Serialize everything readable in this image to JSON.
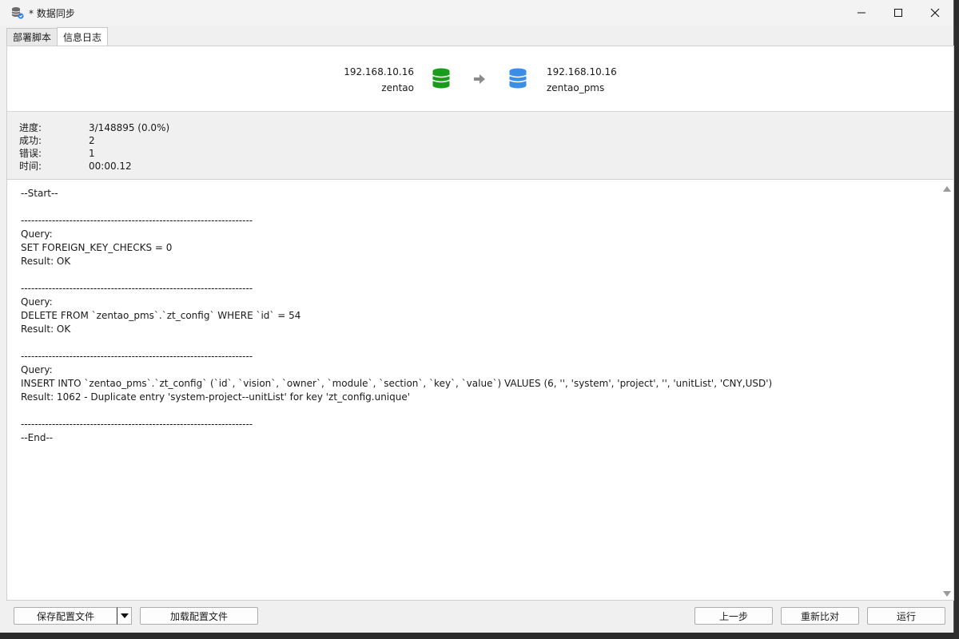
{
  "window": {
    "title": "* 数据同步"
  },
  "tabs": [
    {
      "label": "部署脚本",
      "active": false
    },
    {
      "label": "信息日志",
      "active": true
    }
  ],
  "connection": {
    "source": {
      "host": "192.168.10.16",
      "database": "zentao",
      "color": "#1a9b1a"
    },
    "target": {
      "host": "192.168.10.16",
      "database": "zentao_pms",
      "color": "#3a8ee6"
    }
  },
  "stats": {
    "progress": {
      "label": "进度:",
      "value": "3/148895 (0.0%)"
    },
    "success": {
      "label": "成功:",
      "value": "2"
    },
    "errors": {
      "label": "错误:",
      "value": "1"
    },
    "time": {
      "label": "时间:",
      "value": "00:00.12"
    }
  },
  "log": {
    "text": "--Start--\n\n-------------------------------------------------------------------\nQuery:\nSET FOREIGN_KEY_CHECKS = 0\nResult: OK\n\n-------------------------------------------------------------------\nQuery:\nDELETE FROM `zentao_pms`.`zt_config` WHERE `id` = 54\nResult: OK\n\n-------------------------------------------------------------------\nQuery:\nINSERT INTO `zentao_pms`.`zt_config` (`id`, `vision`, `owner`, `module`, `section`, `key`, `value`) VALUES (6, '', 'system', 'project', '', 'unitList', 'CNY,USD')\nResult: 1062 - Duplicate entry 'system-project--unitList' for key 'zt_config.unique'\n\n-------------------------------------------------------------------\n--End--"
  },
  "buttons": {
    "save_config": "保存配置文件",
    "load_config": "加载配置文件",
    "previous": "上一步",
    "recompare": "重新比对",
    "run": "运行"
  }
}
